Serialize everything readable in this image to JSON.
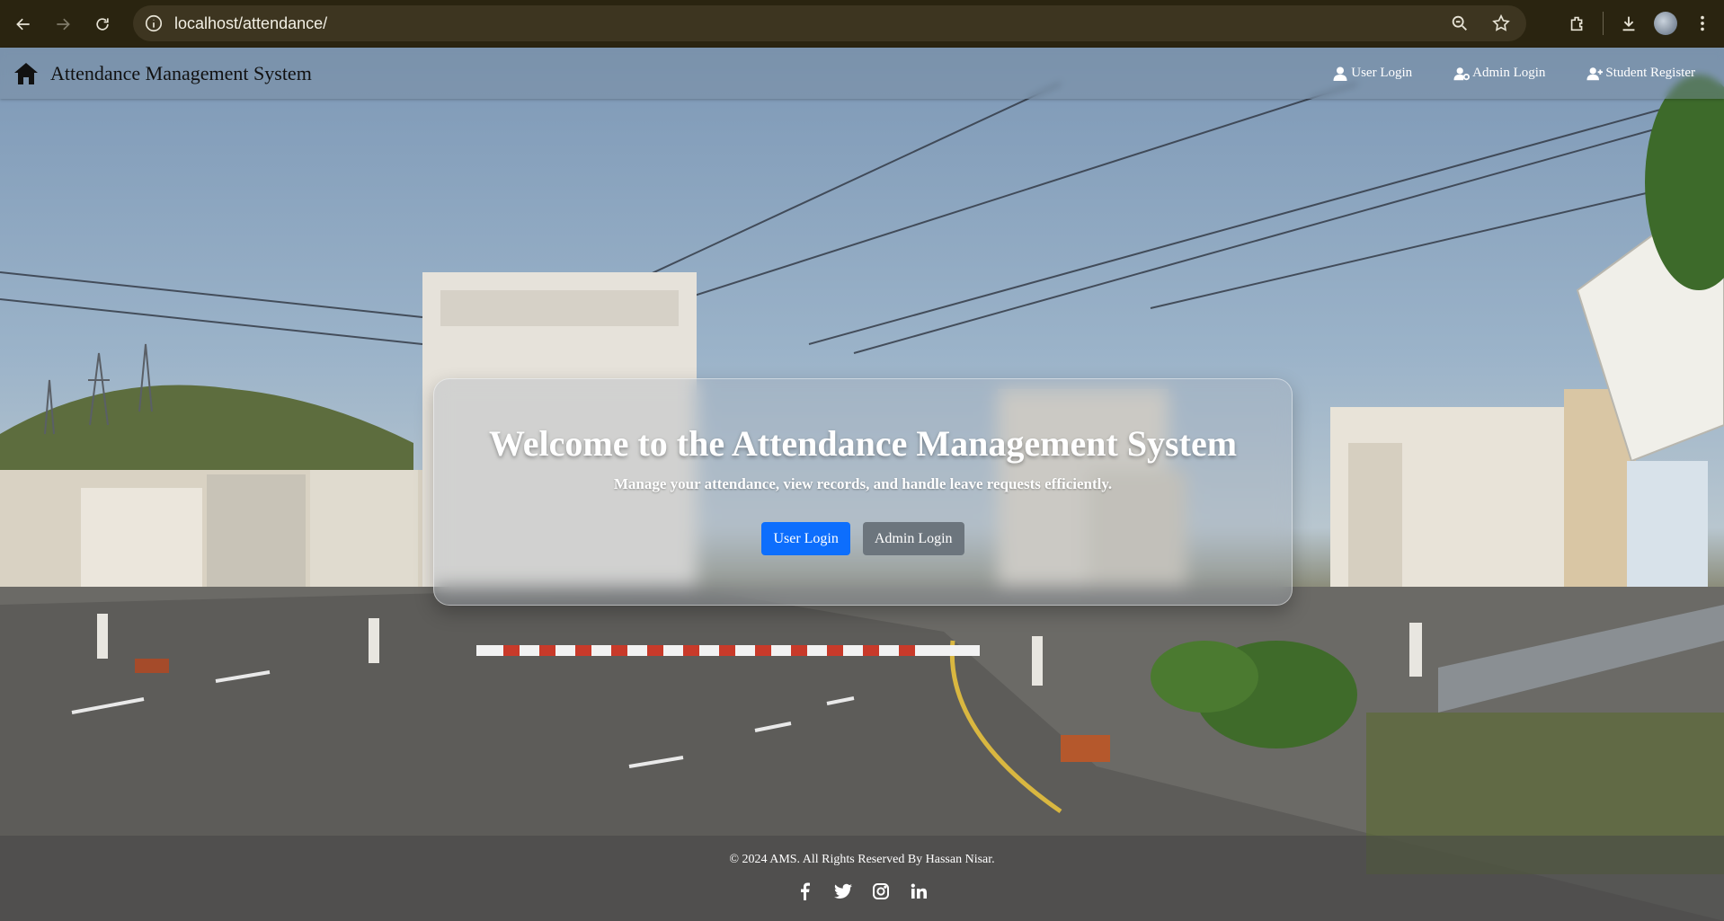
{
  "browser": {
    "url": "localhost/attendance/",
    "icons": [
      "back-arrow-icon",
      "forward-arrow-icon",
      "reload-icon",
      "site-info-icon",
      "zoom-icon",
      "bookmark-star-icon",
      "extensions-icon",
      "download-icon",
      "profile-avatar",
      "menu-dots-icon"
    ]
  },
  "navbar": {
    "brand": "Attendance Management System",
    "brand_icon": "home-icon",
    "links": [
      {
        "label": "User Login",
        "icon": "user-icon"
      },
      {
        "label": "Admin Login",
        "icon": "user-gear-icon"
      },
      {
        "label": "Student Register",
        "icon": "user-plus-icon"
      }
    ]
  },
  "hero": {
    "title": "Welcome to the Attendance Management System",
    "subtitle": "Manage your attendance, view records, and handle leave requests efficiently.",
    "buttons": {
      "user_login": "User Login",
      "admin_login": "Admin Login"
    }
  },
  "footer": {
    "copyright": "© 2024 AMS. All Rights Reserved By Hassan Nisar.",
    "socials": [
      "facebook-icon",
      "twitter-icon",
      "instagram-icon",
      "linkedin-icon"
    ]
  },
  "colors": {
    "primary": "#0d6efd",
    "secondary": "#6c757d",
    "browser_bar": "#2a2410"
  }
}
